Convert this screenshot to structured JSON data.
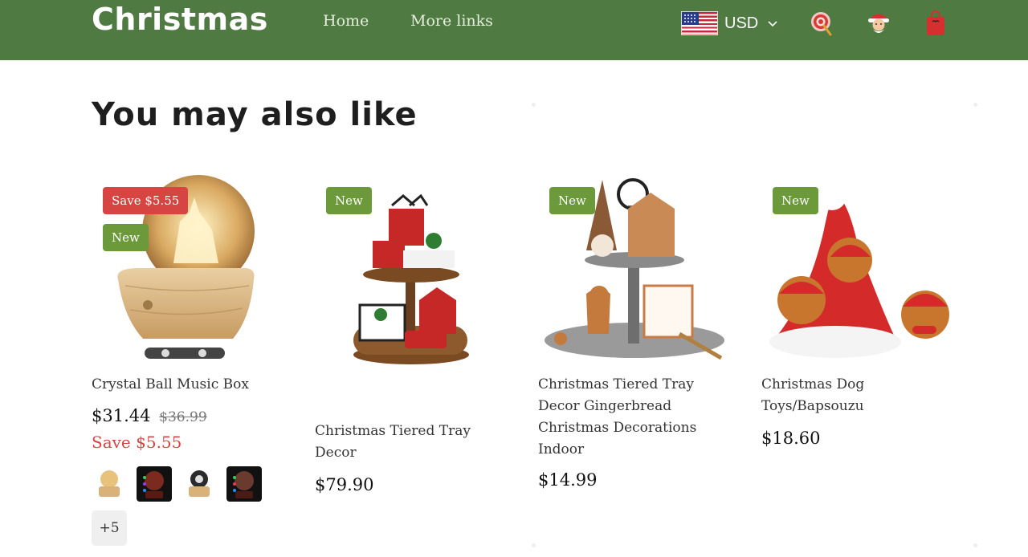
{
  "header": {
    "brand": "Christmas",
    "nav": [
      "Home",
      "More links"
    ],
    "currency": "USD",
    "icons": [
      "us-flag-icon",
      "chevron-down-icon",
      "target-icon",
      "santa-icon",
      "shopping-bag-icon"
    ],
    "colors": {
      "bar": "#4f7a42"
    }
  },
  "section": {
    "title": "You may also like"
  },
  "products": [
    {
      "title": "Crystal Ball Music Box",
      "price": "$31.44",
      "compare_at": "$36.99",
      "save_badge": "Save $5.55",
      "new_badge": "New",
      "save_text": "Save $5.55",
      "more_swatches": "+5"
    },
    {
      "title": "Christmas Tiered Tray Decor",
      "price": "$79.90",
      "new_badge": "New"
    },
    {
      "title": "Christmas Tiered Tray Decor Gingerbread Christmas Decorations Indoor",
      "price": "$14.99",
      "new_badge": "New"
    },
    {
      "title": "Christmas Dog Toys/Bapsouzu",
      "price": "$18.60",
      "new_badge": "New"
    }
  ],
  "colors": {
    "sale": "#d64541",
    "new": "#6c9a3a"
  }
}
